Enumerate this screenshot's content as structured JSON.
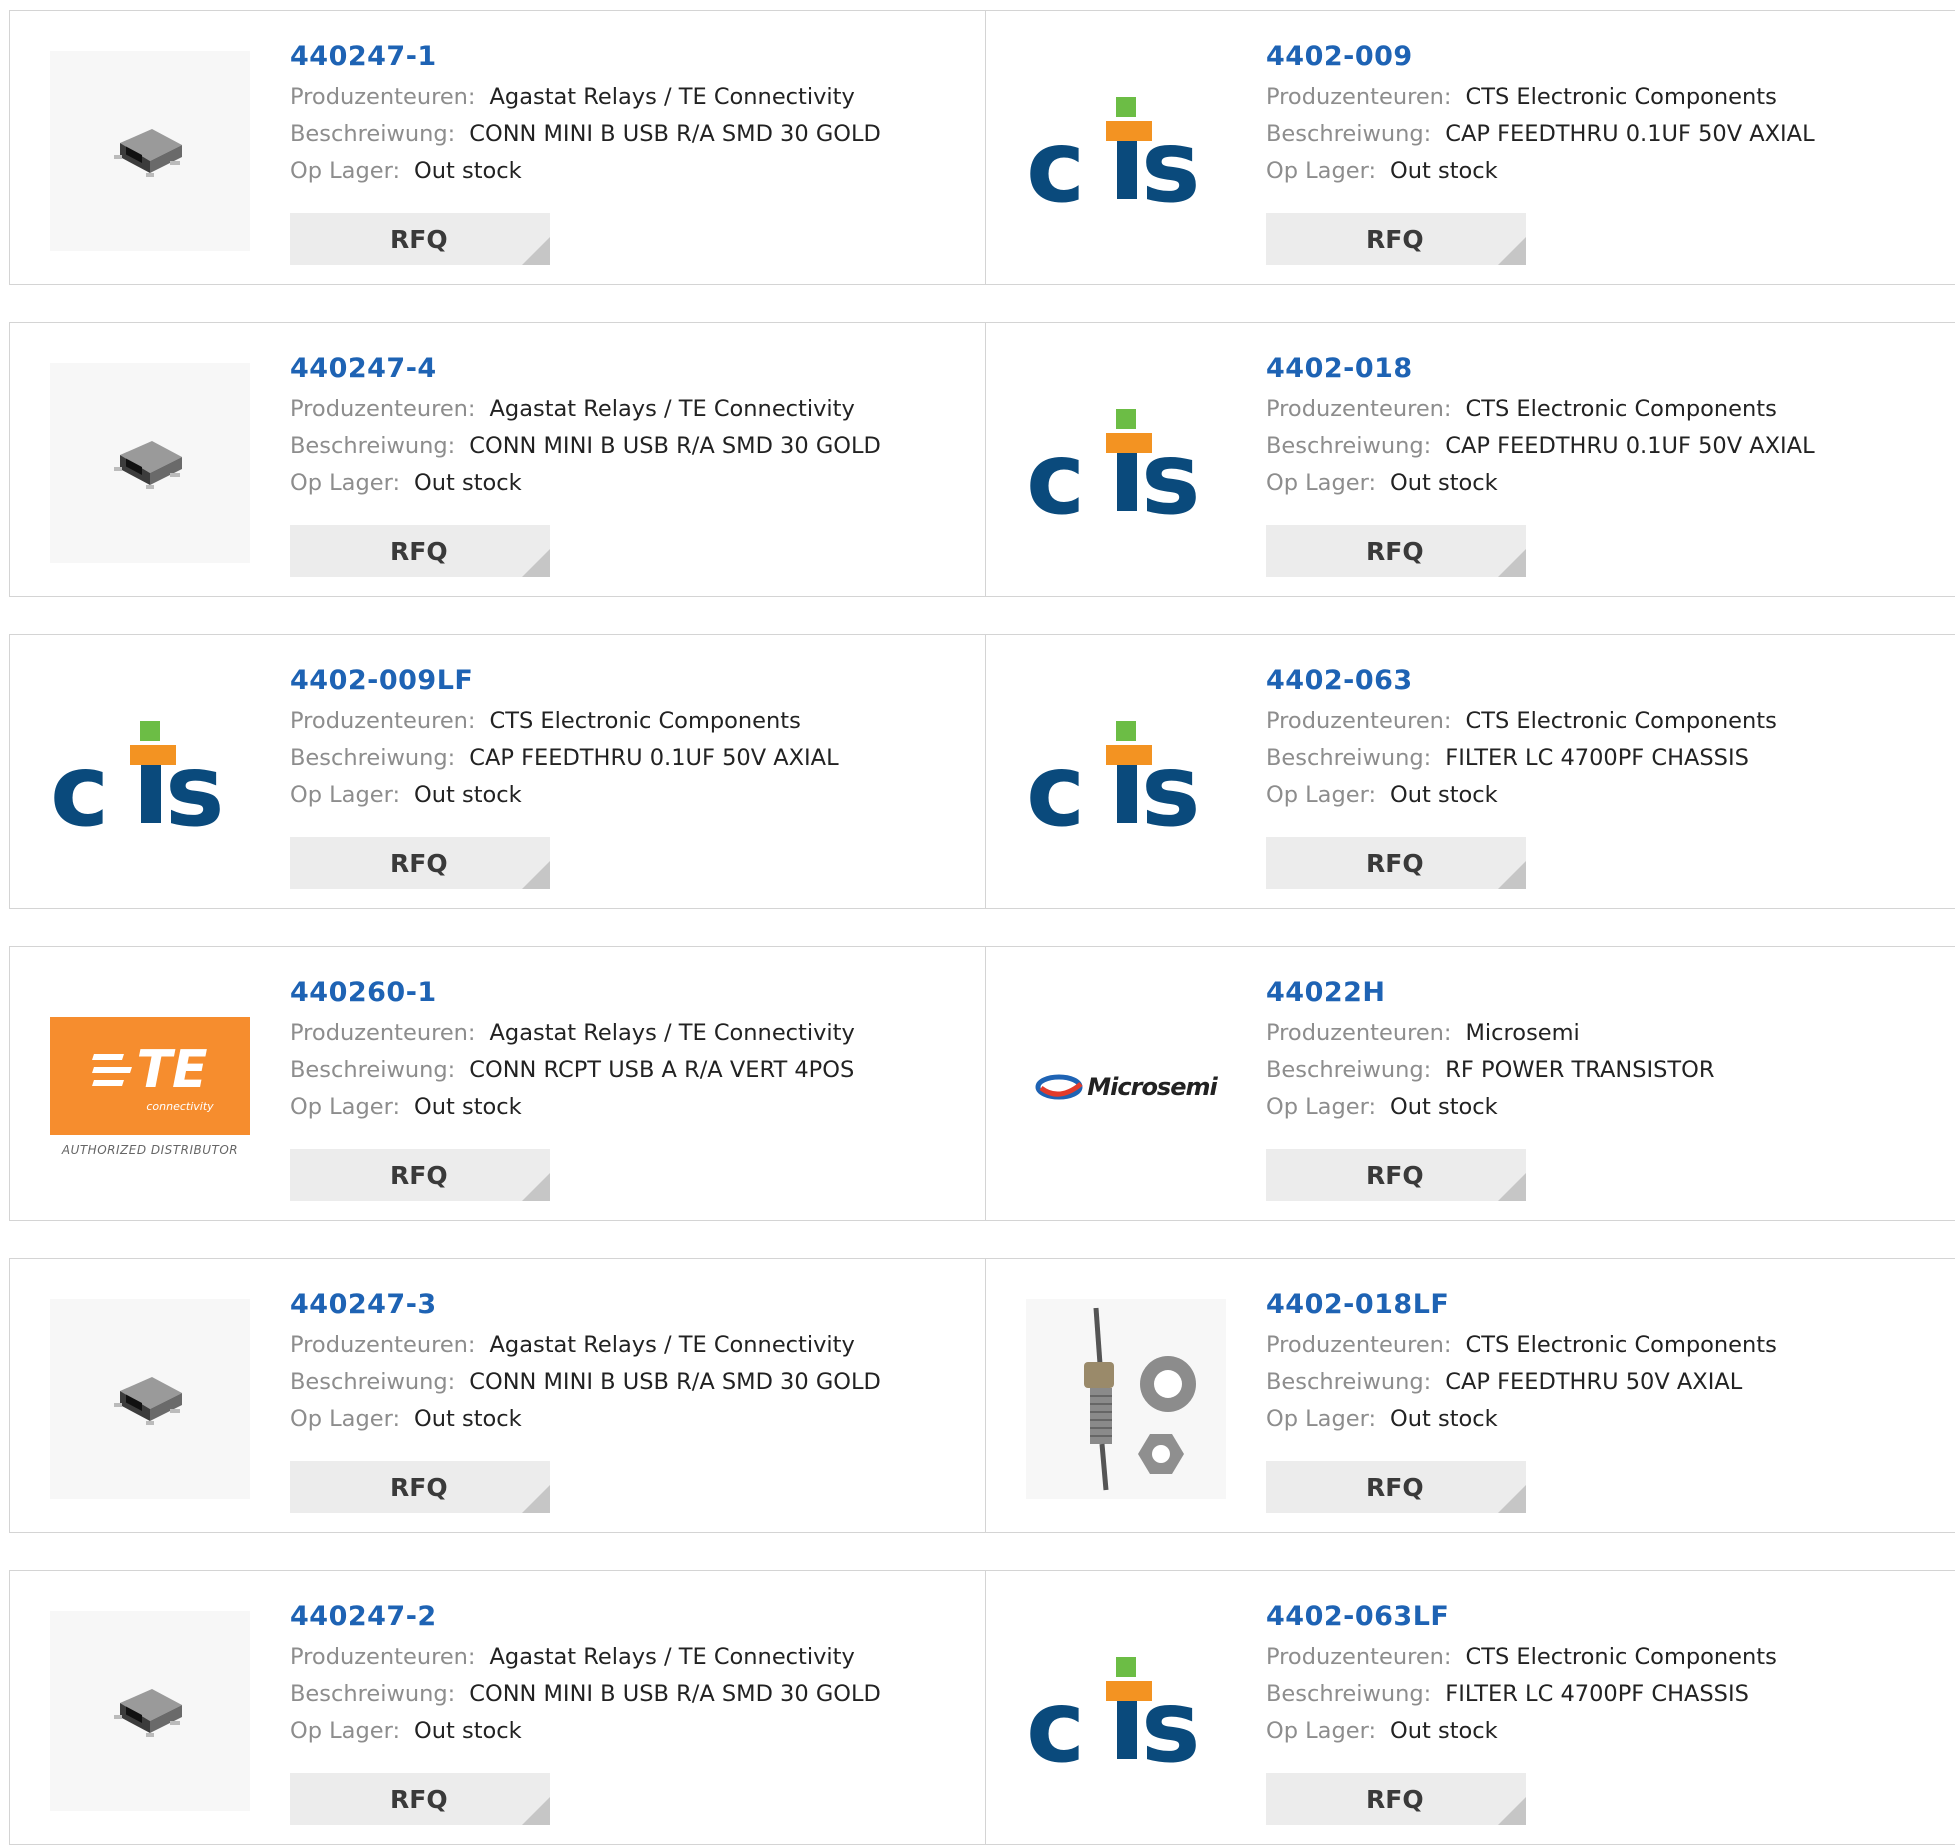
{
  "labels": {
    "manufacturer": "Produzenteuren:",
    "description": "Beschreiwung:",
    "stock": "Op Lager:",
    "rfq": "RFQ"
  },
  "products": [
    {
      "part": "440247-1",
      "manufacturer": "Agastat Relays / TE Connectivity",
      "description": "CONN MINI B USB R/A SMD 30 GOLD",
      "stock": "Out stock",
      "image": "usb-connector-icon"
    },
    {
      "part": "4402-009",
      "manufacturer": "CTS Electronic Components",
      "description": "CAP FEEDTHRU 0.1UF 50V AXIAL",
      "stock": "Out stock",
      "image": "cts-logo"
    },
    {
      "part": "440247-4",
      "manufacturer": "Agastat Relays / TE Connectivity",
      "description": "CONN MINI B USB R/A SMD 30 GOLD",
      "stock": "Out stock",
      "image": "usb-connector-icon"
    },
    {
      "part": "4402-018",
      "manufacturer": "CTS Electronic Components",
      "description": "CAP FEEDTHRU 0.1UF 50V AXIAL",
      "stock": "Out stock",
      "image": "cts-logo"
    },
    {
      "part": "4402-009LF",
      "manufacturer": "CTS Electronic Components",
      "description": "CAP FEEDTHRU 0.1UF 50V AXIAL",
      "stock": "Out stock",
      "image": "cts-logo"
    },
    {
      "part": "4402-063",
      "manufacturer": "CTS Electronic Components",
      "description": "FILTER LC 4700PF CHASSIS",
      "stock": "Out stock",
      "image": "cts-logo"
    },
    {
      "part": "440260-1",
      "manufacturer": "Agastat Relays / TE Connectivity",
      "description": "CONN RCPT USB A R/A VERT 4POS",
      "stock": "Out stock",
      "image": "te-connectivity-logo",
      "logo_text": {
        "main": "TE",
        "sub": "connectivity",
        "caption": "AUTHORIZED DISTRIBUTOR"
      }
    },
    {
      "part": "44022H",
      "manufacturer": "Microsemi",
      "description": "RF POWER TRANSISTOR",
      "stock": "Out stock",
      "image": "microsemi-logo",
      "logo_text": {
        "main": "Microsemi"
      }
    },
    {
      "part": "440247-3",
      "manufacturer": "Agastat Relays / TE Connectivity",
      "description": "CONN MINI B USB R/A SMD 30 GOLD",
      "stock": "Out stock",
      "image": "usb-connector-icon"
    },
    {
      "part": "4402-018LF",
      "manufacturer": "CTS Electronic Components",
      "description": "CAP FEEDTHRU 50V AXIAL",
      "stock": "Out stock",
      "image": "feedthrough-capacitor-icon"
    },
    {
      "part": "440247-2",
      "manufacturer": "Agastat Relays / TE Connectivity",
      "description": "CONN MINI B USB R/A SMD 30 GOLD",
      "stock": "Out stock",
      "image": "usb-connector-icon"
    },
    {
      "part": "4402-063LF",
      "manufacturer": "CTS Electronic Components",
      "description": "FILTER LC 4700PF CHASSIS",
      "stock": "Out stock",
      "image": "cts-logo"
    }
  ],
  "colors": {
    "link": "#1e63b4",
    "label": "#8d8d8d",
    "value": "#222222",
    "cts_blue": "#0a4a7c",
    "cts_orange": "#f39322",
    "cts_green": "#6cbd45",
    "te_orange": "#f68d2e"
  }
}
